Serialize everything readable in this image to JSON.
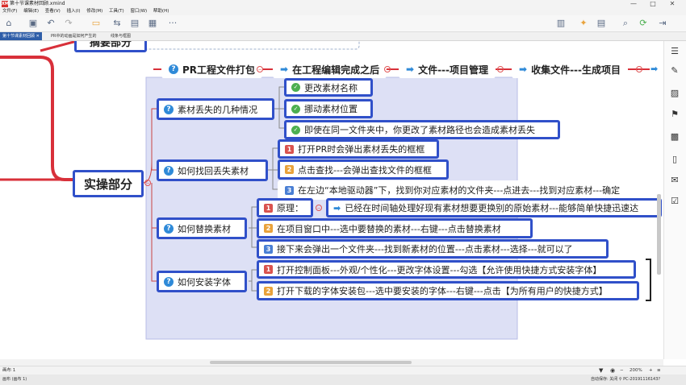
{
  "window": {
    "title": "第十节课素材回顾.xmind",
    "logo": "XM",
    "minimize": "—",
    "maximize": "□",
    "close": "✕"
  },
  "menu": [
    "文件(F)",
    "编辑(E)",
    "查看(V)",
    "插入(I)",
    "修改(M)",
    "工具(T)",
    "窗口(W)",
    "帮助(H)"
  ],
  "toolbar": {
    "more": "···"
  },
  "tabs": [
    {
      "label": "第十节课素材回顾",
      "active": true
    },
    {
      "label": "PR中的动画是如何产生的",
      "active": false
    },
    {
      "label": "线条与框图",
      "active": false
    }
  ],
  "top_node": {
    "label": "摘要部分"
  },
  "root": {
    "label": "实操部分"
  },
  "top_row": [
    {
      "icon": "question",
      "label": "PR工程文件打包"
    },
    {
      "icon": "arrow",
      "label": "在工程编辑完成之后"
    },
    {
      "icon": "arrow",
      "label": "文件---项目管理"
    },
    {
      "icon": "arrow",
      "label": "收集文件---生成项目"
    }
  ],
  "branches": {
    "b1": {
      "label": "素材丢失的几种情况",
      "items": [
        "更改素材名称",
        "挪动素材位置",
        "即使在同一文件夹中，你更改了素材路径也会造成素材丢失"
      ]
    },
    "b2": {
      "label": "如何找回丢失素材",
      "items": [
        "打开PR时会弹出素材丢失的框框",
        "点击查找---会弹出查找文件的框框",
        "在左边“本地驱动器”下，找到你对应素材的文件夹---点进去---找到对应素材---确定"
      ]
    },
    "b3": {
      "label": "如何替换素材",
      "principle": "原理：",
      "principle_text": "已经在时间轴处理好现有素材想要更换别的原始素材---能够简单快捷迅速达",
      "items": [
        "在项目窗口中---选中要替换的素材---右键---点击替换素材",
        "接下来会弹出一个文件夹---找到新素材的位置---点击素材---选择---就可以了"
      ]
    },
    "b4": {
      "label": "如何安装字体",
      "items": [
        "打开控制面板---外观/个性化---更改字体设置---勾选【允许使用快捷方式安装字体】",
        "打开下载的字体安装包---选中要安装的字体---右键---点击【为所有用户的快捷方式】"
      ]
    }
  },
  "badges": [
    "1",
    "2",
    "3"
  ],
  "status": {
    "left": "画布 1",
    "zoom": "200%",
    "bottom_left": "画布 (画布 1)",
    "bottom_right": "自动保存: 关闭  ⚲  PC-20191116143?"
  },
  "colors": {
    "node_border": "#3050c9",
    "root_line": "#d8303a",
    "selection": "#dde0f5",
    "accent": "#2f8ad8"
  }
}
